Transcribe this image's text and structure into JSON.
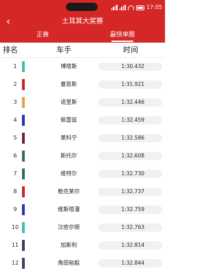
{
  "status_bar": {
    "time": "17:05"
  },
  "header": {
    "back_icon": "chevron-left-icon",
    "title": "土耳其大奖赛"
  },
  "tabs": [
    {
      "label": "正赛",
      "active": false
    },
    {
      "label": "最快单圈",
      "active": true
    }
  ],
  "colors": {
    "brand_red": "#d62727",
    "time_pill": "#f1f1f1"
  },
  "table": {
    "headers": {
      "rank": "排名",
      "driver": "车手",
      "time": "时间"
    },
    "rows": [
      {
        "pos": "1",
        "driver": "博塔斯",
        "time": "1:30.432",
        "color": "#3fbfae"
      },
      {
        "pos": "2",
        "driver": "塞恩斯",
        "time": "1:31.921",
        "color": "#c8202d"
      },
      {
        "pos": "3",
        "driver": "诺里斯",
        "time": "1:32.446",
        "color": "#e8a14c"
      },
      {
        "pos": "4",
        "driver": "佩雷兹",
        "time": "1:32.459",
        "color": "#2a2fb8"
      },
      {
        "pos": "5",
        "driver": "莱科宁",
        "time": "1:32.586",
        "color": "#7a1e2e"
      },
      {
        "pos": "6",
        "driver": "斯托尔",
        "time": "1:32.608",
        "color": "#2e6e5c"
      },
      {
        "pos": "7",
        "driver": "维特尔",
        "time": "1:32.730",
        "color": "#2e6e5c"
      },
      {
        "pos": "8",
        "driver": "勒克莱尔",
        "time": "1:32.737",
        "color": "#c8202d"
      },
      {
        "pos": "9",
        "driver": "维斯塔潘",
        "time": "1:32.759",
        "color": "#2a2fb8"
      },
      {
        "pos": "10",
        "driver": "汉密尔顿",
        "time": "1:32.763",
        "color": "#3fbfae"
      },
      {
        "pos": "11",
        "driver": "加斯利",
        "time": "1:32.814",
        "color": "#3a3f5a"
      },
      {
        "pos": "12",
        "driver": "角田裕毅",
        "time": "1:32.844",
        "color": "#3a3f5a"
      }
    ]
  }
}
